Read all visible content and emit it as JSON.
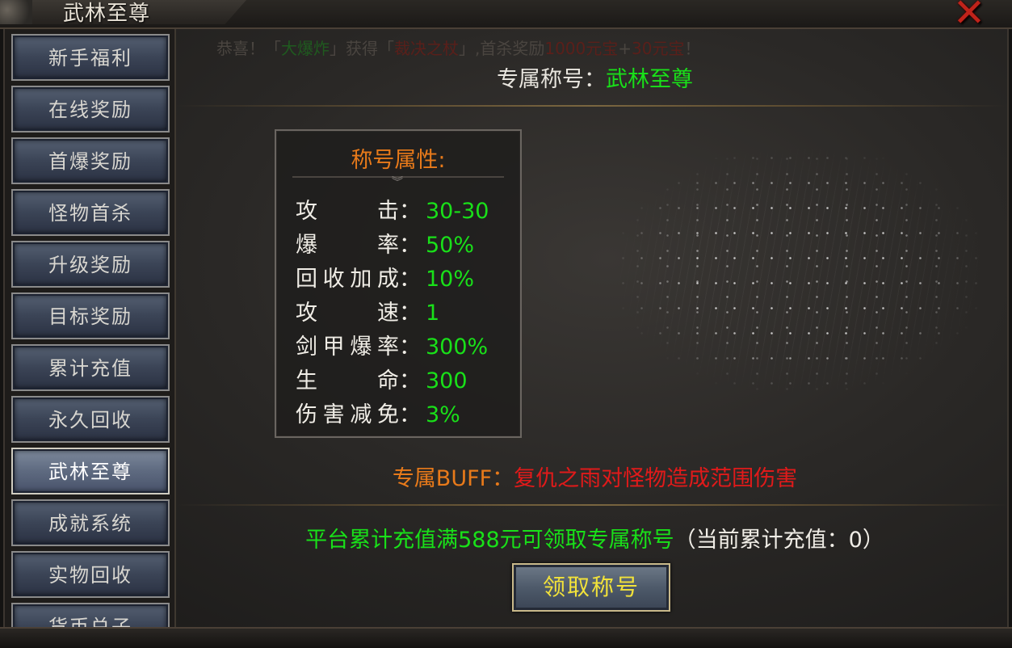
{
  "window": {
    "title": "武林至尊",
    "close_icon": "close-x-icon"
  },
  "sidebar": {
    "items": [
      {
        "label": "新手福利",
        "active": false
      },
      {
        "label": "在线奖励",
        "active": false
      },
      {
        "label": "首爆奖励",
        "active": false
      },
      {
        "label": "怪物首杀",
        "active": false
      },
      {
        "label": "升级奖励",
        "active": false
      },
      {
        "label": "目标奖励",
        "active": false
      },
      {
        "label": "累计充值",
        "active": false
      },
      {
        "label": "永久回收",
        "active": false
      },
      {
        "label": "武林至尊",
        "active": true
      },
      {
        "label": "成就系统",
        "active": false
      },
      {
        "label": "实物回收",
        "active": false
      },
      {
        "label": "货币兑子",
        "active": false
      }
    ]
  },
  "ticker": {
    "prefix": "恭喜！「",
    "player": "大爆炸",
    "mid": "」获得「",
    "item": "裁决之杖",
    "suffix": "」,首杀奖励",
    "reward1": "1000元宝",
    "plus": "+",
    "reward2": "30元宝",
    "end": "！"
  },
  "main": {
    "heading_label": "专属称号：",
    "heading_value": "武林至尊",
    "attr_title": "称号属性:",
    "attributes": [
      {
        "label": "攻击",
        "value": "30-30"
      },
      {
        "label": "爆率",
        "value": "50%"
      },
      {
        "label": "回收加成",
        "value": "10%"
      },
      {
        "label": "攻速",
        "value": "1"
      },
      {
        "label": "剑甲爆率",
        "value": "300%"
      },
      {
        "label": "生命",
        "value": "300"
      },
      {
        "label": "伤害减免",
        "value": "3%"
      }
    ],
    "colon": "：",
    "buff_label": "专属BUFF：",
    "buff_text": "复仇之雨对怪物造成范围伤害",
    "recharge_text": "平台累计充值满588元可领取专属称号",
    "recharge_current": "（当前累计充值：0）",
    "claim_button": "领取称号"
  },
  "colors": {
    "green": "#19e019",
    "orange": "#e87a1a",
    "red": "#e01a1a",
    "yellow": "#f2e23a"
  }
}
